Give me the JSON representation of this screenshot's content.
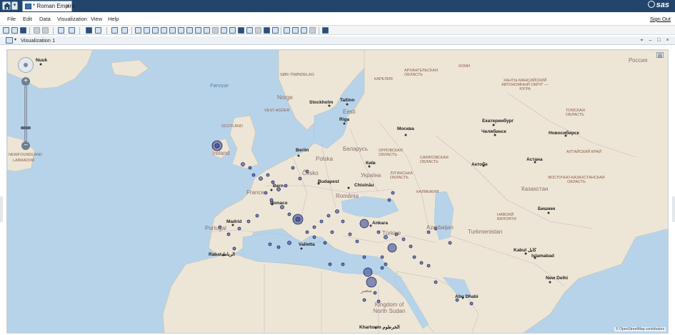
{
  "titlebar": {
    "tab_label": "* Roman Empire",
    "tab_close": "×",
    "logo_text": "sas"
  },
  "menu": {
    "items": [
      "File",
      "Edit",
      "Data",
      "Visualization",
      "View",
      "Help"
    ],
    "sign_out": "Sign Out"
  },
  "visualization": {
    "title": "Visualization 1"
  },
  "map": {
    "attribution": "© OpenStreetMap contributors",
    "cities": [
      {
        "name": "Nuuk"
      },
      {
        "name": "Tallinn"
      },
      {
        "name": "Stockholm"
      },
      {
        "name": "Riga"
      },
      {
        "name": "Москва"
      },
      {
        "name": "Екатеринбург"
      },
      {
        "name": "Челябинск"
      },
      {
        "name": "Новосибирск"
      },
      {
        "name": "Berlin"
      },
      {
        "name": "Київ"
      },
      {
        "name": "Budapest"
      },
      {
        "name": "Chisinău"
      },
      {
        "name": "Bern"
      },
      {
        "name": "Monaco"
      },
      {
        "name": "Madrid"
      },
      {
        "name": "Rabat الرباط"
      },
      {
        "name": "Valletta"
      },
      {
        "name": "Ankara"
      },
      {
        "name": "Астана"
      },
      {
        "name": "Бишкек"
      },
      {
        "name": "Kabul کابل"
      },
      {
        "name": "Islamabad"
      },
      {
        "name": "New Delhi"
      },
      {
        "name": "Abu Dhabi"
      },
      {
        "name": "Khartoum الخرطوم"
      },
      {
        "name": "Актобе"
      }
    ],
    "regions": [
      {
        "name": "SØR-TRØNDELAG"
      },
      {
        "name": "КАРЕЛИЯ"
      },
      {
        "name": "АРХАНГЕЛЬСКАЯ ОБЛАСТЬ"
      },
      {
        "name": "КОМИ"
      },
      {
        "name": "ХАНТЫ-МАНСИЙСКИЙ АВТОНОМНЫЙ ОКРУГ — ЮГРА"
      },
      {
        "name": "ТОМСКАЯ ОБЛАСТЬ"
      },
      {
        "name": "VEST-AGDER"
      },
      {
        "name": "ОРЛОВСКАЯ ОБЛАСТЬ"
      },
      {
        "name": "САРАТОВСКАЯ ОБЛАСТЬ"
      },
      {
        "name": "ЛУГАНСЬКА ОБЛАСТЬ"
      },
      {
        "name": "КАЛМЫКИЯ"
      },
      {
        "name": "АЛТАЙСКИЙ КРАЙ"
      },
      {
        "name": "ВОСТОЧНО-КАЗАХСТАНСКАЯ ОБЛАСТЬ"
      },
      {
        "name": "НАВОИЙ ВИЛОЯТИ"
      },
      {
        "name": "SCOTLAND"
      },
      {
        "name": "LABRADOR"
      }
    ],
    "countries": [
      {
        "name": "Ireland"
      },
      {
        "name": "Polska"
      },
      {
        "name": "Беларусь"
      },
      {
        "name": "Česko"
      },
      {
        "name": "Україна"
      },
      {
        "name": "România"
      },
      {
        "name": "France"
      },
      {
        "name": "Portugal"
      },
      {
        "name": "Türkiye"
      },
      {
        "name": "Azerbaijan"
      },
      {
        "name": "Казахстан"
      },
      {
        "name": "Turkmenistan"
      },
      {
        "name": "Россия"
      },
      {
        "name": "Kingdom of North Sudan"
      },
      {
        "name": "مصر"
      },
      {
        "name": "Eesti"
      },
      {
        "name": "Norge"
      }
    ],
    "seas": [
      {
        "name": "Føroyar"
      }
    ],
    "newfoundland": "NEWFOUNDLAND"
  }
}
